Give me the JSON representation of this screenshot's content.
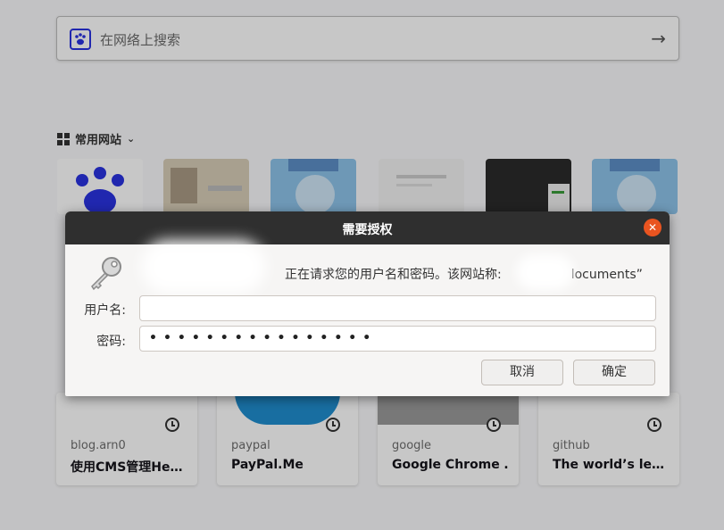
{
  "search": {
    "placeholder": "在网络上搜索",
    "engine_icon": "baidu-paw-icon"
  },
  "top_sites": {
    "section_title": "常用网站",
    "tiles": [
      {
        "name": "baidu",
        "color": "#2932e1"
      },
      {
        "name": "site-2",
        "color": "#c9b79c"
      },
      {
        "name": "site-3",
        "color": "#7db3e0"
      },
      {
        "name": "site-4",
        "color": "#eeeeee"
      },
      {
        "name": "site-5",
        "color": "#2b2b2b"
      },
      {
        "name": "site-6",
        "color": "#7db3e0"
      }
    ]
  },
  "highlights": [
    {
      "host": "blog.arn0",
      "title": "使用CMS管理He…"
    },
    {
      "host": "paypal",
      "title": "PayPal.Me"
    },
    {
      "host": "google",
      "title": "Google Chrome …"
    },
    {
      "host": "github",
      "title": "The world’s le…"
    }
  ],
  "dialog": {
    "title": "需要授权",
    "message": "正在请求您的用户名和密码。该网站称:",
    "message_tail": "locuments”",
    "username_label": "用户名:",
    "username_value": "",
    "password_label": "密码:",
    "password_value": "••••••••••••••••",
    "cancel_label": "取消",
    "ok_label": "确定",
    "close_color": "#e95420"
  }
}
